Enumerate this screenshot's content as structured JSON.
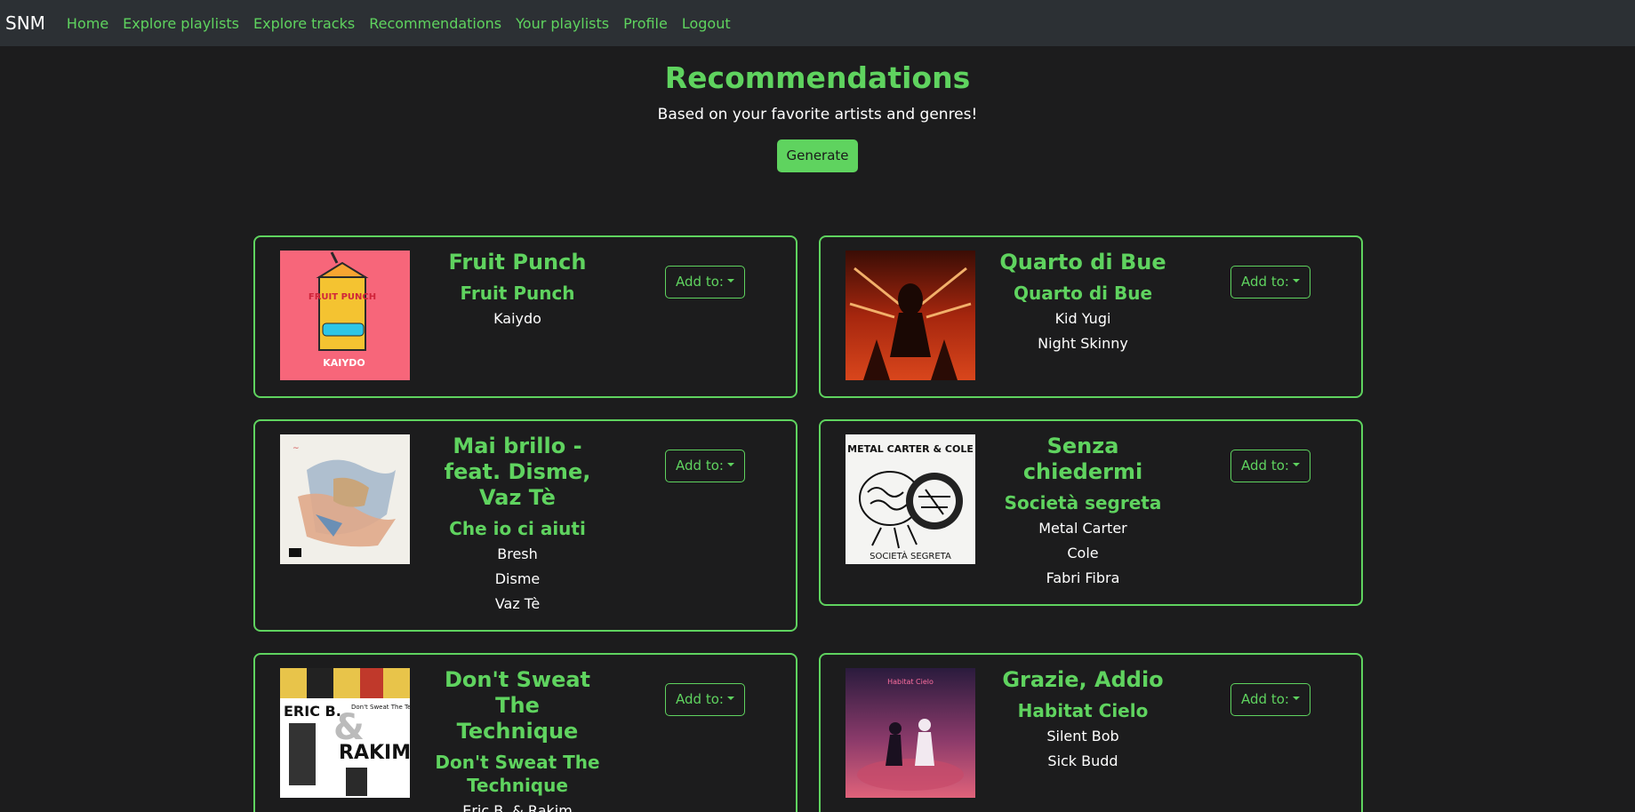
{
  "nav": {
    "brand": "SNM",
    "links": [
      "Home",
      "Explore playlists",
      "Explore tracks",
      "Recommendations",
      "Your playlists",
      "Profile",
      "Logout"
    ]
  },
  "header": {
    "title": "Recommendations",
    "subtitle": "Based on your favorite artists and genres!",
    "generate_label": "Generate"
  },
  "add_label": "Add to:",
  "cards": [
    {
      "title": "Fruit Punch",
      "album": "Fruit Punch",
      "artists": [
        "Kaiydo"
      ]
    },
    {
      "title": "Quarto di Bue",
      "album": "Quarto di Bue",
      "artists": [
        "Kid Yugi",
        "Night Skinny"
      ]
    },
    {
      "title": "Mai brillo - feat. Disme, Vaz Tè",
      "album": "Che io ci aiuti",
      "artists": [
        "Bresh",
        "Disme",
        "Vaz Tè"
      ]
    },
    {
      "title": "Senza chiedermi",
      "album": "Società segreta",
      "artists": [
        "Metal Carter",
        "Cole",
        "Fabri Fibra"
      ]
    },
    {
      "title": "Don't Sweat The Technique",
      "album": "Don't Sweat The Technique",
      "artists": [
        "Eric B. & Rakim"
      ]
    },
    {
      "title": "Grazie, Addio",
      "album": "Habitat Cielo",
      "artists": [
        "Silent Bob",
        "Sick Budd"
      ]
    }
  ],
  "cover_art": {
    "c0": {
      "brand": "FRUIT PUNCH",
      "sig": "KAIYDO"
    },
    "c3": {
      "band": "METAL CARTER & COLE",
      "sub": "SOCIETÀ SEGRETA"
    },
    "c4": {
      "line1": "ERIC B.",
      "amp": "&",
      "line2": "RAKIM",
      "side": "Don't Sweat The Technique"
    },
    "c5": {
      "logo": "Habitat Cielo"
    }
  },
  "colors": {
    "accent": "#5fd35f",
    "navbar": "#2c3034",
    "background": "#1c1c1d"
  }
}
